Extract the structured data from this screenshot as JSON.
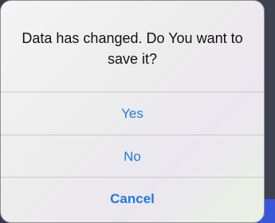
{
  "alert": {
    "message": "Data has changed. Do You want to save it?",
    "buttons": {
      "yes": "Yes",
      "no": "No",
      "cancel": "Cancel"
    }
  },
  "colors": {
    "button_text": "#1f7ae0",
    "message_text": "#111111",
    "separator": "#c9c9c9"
  }
}
